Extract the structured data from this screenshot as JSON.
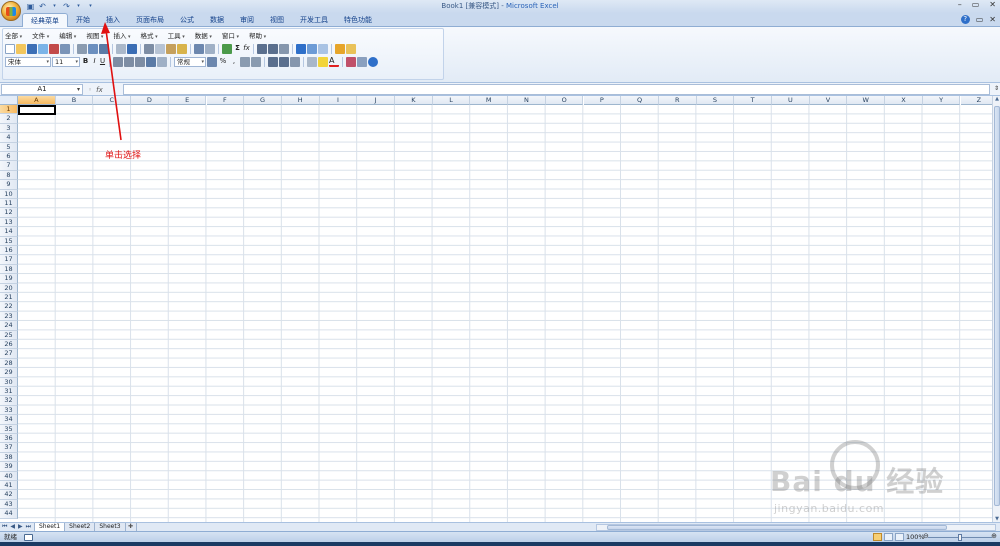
{
  "window": {
    "title_doc": "Book1  [兼容模式] - ",
    "title_app": "Microsoft Excel",
    "controls": [
      "–",
      "▭",
      "✕"
    ]
  },
  "ribbon_tabs": [
    {
      "label": "经典菜单",
      "active": true
    },
    {
      "label": "开始",
      "active": false
    },
    {
      "label": "插入",
      "active": false
    },
    {
      "label": "页面布局",
      "active": false
    },
    {
      "label": "公式",
      "active": false
    },
    {
      "label": "数据",
      "active": false
    },
    {
      "label": "审阅",
      "active": false
    },
    {
      "label": "视图",
      "active": false
    },
    {
      "label": "开发工具",
      "active": false
    },
    {
      "label": "特色功能",
      "active": false
    }
  ],
  "classic_menus": [
    "全部",
    "文件",
    "编辑",
    "视图",
    "插入",
    "格式",
    "工具",
    "数据",
    "窗口",
    "帮助"
  ],
  "toolbar": {
    "font_name": "宋体",
    "font_size": "11",
    "number_format": "常规",
    "bold_label": "B",
    "italic_label": "I",
    "underline_label": "U",
    "percent_label": "%",
    "comma_label": ",",
    "sum_label": "Σ",
    "fx_label": "fx",
    "font_color_label": "A"
  },
  "formula_bar": {
    "name_box": "A1",
    "fx": "fx",
    "formula": ""
  },
  "columns": [
    "A",
    "B",
    "C",
    "D",
    "E",
    "F",
    "G",
    "H",
    "I",
    "J",
    "K",
    "L",
    "M",
    "N",
    "O",
    "P",
    "Q",
    "R",
    "S",
    "T",
    "U",
    "V",
    "W",
    "X",
    "Y",
    "Z"
  ],
  "selected_column": "A",
  "rows": [
    "1",
    "2",
    "3",
    "4",
    "5",
    "6",
    "7",
    "8",
    "9",
    "10",
    "11",
    "12",
    "13",
    "14",
    "15",
    "16",
    "17",
    "18",
    "19",
    "20",
    "21",
    "22",
    "23",
    "24",
    "25",
    "26",
    "27",
    "28",
    "29",
    "30",
    "31",
    "32",
    "33",
    "34",
    "35",
    "36",
    "37",
    "38",
    "39",
    "40",
    "41",
    "42",
    "43",
    "44"
  ],
  "selected_row": "1",
  "annotation": "单击选择",
  "sheets": [
    {
      "label": "Sheet1",
      "active": true
    },
    {
      "label": "Sheet2",
      "active": false
    },
    {
      "label": "Sheet3",
      "active": false
    }
  ],
  "status": {
    "ready": "就绪",
    "zoom": "100%"
  },
  "watermark": {
    "main": "Bai du 经验",
    "sub": "jingyan.baidu.com"
  },
  "colors": {
    "accent": "#15428b",
    "selection_header": "#f7b960",
    "annotation": "#e01010"
  }
}
